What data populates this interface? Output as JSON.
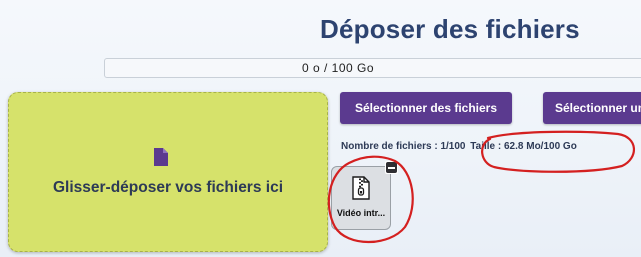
{
  "page": {
    "title": "Déposer des fichiers"
  },
  "quota": {
    "label": "0 o / 100 Go",
    "used_fraction": 0
  },
  "dropzone": {
    "label": "Glisser-déposer vos fichiers ici",
    "icon": "file-icon",
    "color": "#d6e26b"
  },
  "buttons": {
    "select_files": "Sélectionner des fichiers",
    "select_folder": "Sélectionner un",
    "color": "#5b3a8f"
  },
  "stats": {
    "count_text": "Nombre de fichiers : 1/100",
    "size_text": "Taille : 62.8 Mo/100 Go"
  },
  "files": [
    {
      "name": "Vidéo intr...",
      "icon": "zip-file-icon",
      "remove_icon": "minus-icon"
    }
  ],
  "annotations": {
    "color": "#d42020"
  }
}
